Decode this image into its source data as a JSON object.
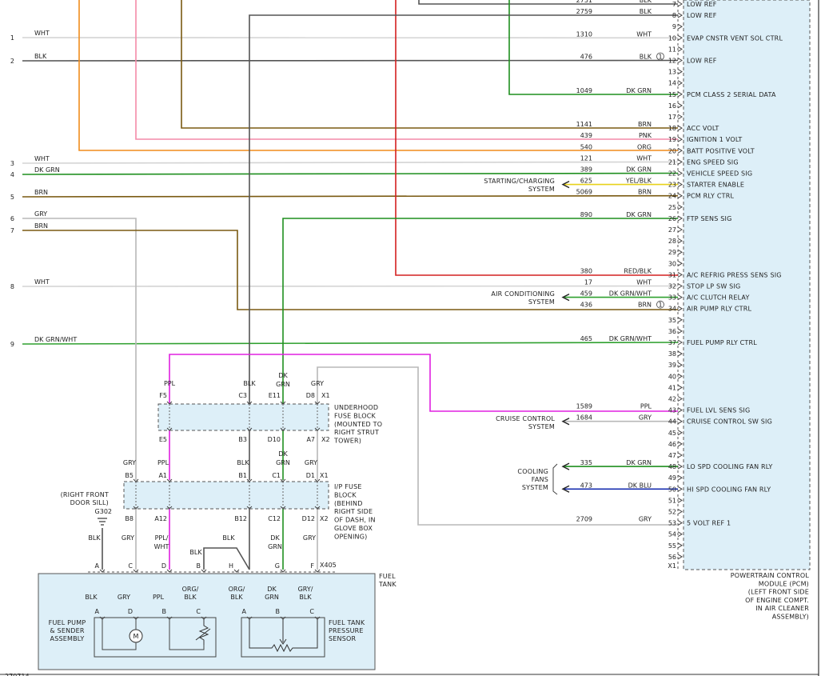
{
  "colors": {
    "WHT": "#d4d4d4",
    "BLK": "#555555",
    "DK GRN": "#1f8f1f",
    "BRN": "#7a5a12",
    "GRY": "#b8b8b8",
    "DK GRN/WHT": "#2fa02f",
    "PNK": "#f48aa8",
    "ORG": "#f08c1c",
    "RED/BLK": "#d42020",
    "PPL": "#e020e0",
    "YEL/BLK": "#e8d21a",
    "DK BLU": "#1a2fb0",
    "module_fill": "#ddeff8",
    "frame": "#444444"
  },
  "pcm": {
    "pins": [
      {
        "pin": "7",
        "wire_no": "2751",
        "color": "BLK",
        "name": "LOW REF"
      },
      {
        "pin": "8",
        "wire_no": "2759",
        "color": "BLK",
        "name": "LOW REF"
      },
      {
        "pin": "9",
        "wire_no": "",
        "color": "",
        "name": ""
      },
      {
        "pin": "10",
        "wire_no": "1310",
        "color": "WHT",
        "name": "EVAP CNSTR VENT SOL CTRL"
      },
      {
        "pin": "11",
        "wire_no": "",
        "color": "",
        "name": ""
      },
      {
        "pin": "12",
        "wire_no": "476",
        "color": "BLK",
        "name": "LOW REF",
        "note": "1"
      },
      {
        "pin": "13",
        "wire_no": "",
        "color": "",
        "name": ""
      },
      {
        "pin": "14",
        "wire_no": "",
        "color": "",
        "name": ""
      },
      {
        "pin": "15",
        "wire_no": "1049",
        "color": "DK GRN",
        "name": "PCM CLASS 2 SERIAL DATA"
      },
      {
        "pin": "16",
        "wire_no": "",
        "color": "",
        "name": ""
      },
      {
        "pin": "17",
        "wire_no": "",
        "color": "",
        "name": ""
      },
      {
        "pin": "18",
        "wire_no": "1141",
        "color": "BRN",
        "name": "ACC VOLT"
      },
      {
        "pin": "19",
        "wire_no": "439",
        "color": "PNK",
        "name": "IGNITION 1 VOLT"
      },
      {
        "pin": "20",
        "wire_no": "540",
        "color": "ORG",
        "name": "BATT POSITIVE VOLT"
      },
      {
        "pin": "21",
        "wire_no": "121",
        "color": "WHT",
        "name": "ENG SPEED SIG"
      },
      {
        "pin": "22",
        "wire_no": "389",
        "color": "DK GRN",
        "name": "VEHICLE SPEED SIG"
      },
      {
        "pin": "23",
        "wire_no": "625",
        "color": "YEL/BLK",
        "name": "STARTER ENABLE"
      },
      {
        "pin": "24",
        "wire_no": "5069",
        "color": "BRN",
        "name": "PCM RLY CTRL"
      },
      {
        "pin": "25",
        "wire_no": "",
        "color": "",
        "name": ""
      },
      {
        "pin": "26",
        "wire_no": "890",
        "color": "DK GRN",
        "name": "FTP SENS SIG"
      },
      {
        "pin": "27",
        "wire_no": "",
        "color": "",
        "name": ""
      },
      {
        "pin": "28",
        "wire_no": "",
        "color": "",
        "name": ""
      },
      {
        "pin": "29",
        "wire_no": "",
        "color": "",
        "name": ""
      },
      {
        "pin": "30",
        "wire_no": "",
        "color": "",
        "name": ""
      },
      {
        "pin": "31",
        "wire_no": "380",
        "color": "RED/BLK",
        "name": "A/C REFRIG PRESS SENS SIG"
      },
      {
        "pin": "32",
        "wire_no": "17",
        "color": "WHT",
        "name": "STOP LP SW SIG"
      },
      {
        "pin": "33",
        "wire_no": "459",
        "color": "DK GRN/WHT",
        "name": "A/C CLUTCH RELAY"
      },
      {
        "pin": "34",
        "wire_no": "436",
        "color": "BRN",
        "name": "AIR PUMP RLY CTRL",
        "note": "1"
      },
      {
        "pin": "35",
        "wire_no": "",
        "color": "",
        "name": ""
      },
      {
        "pin": "36",
        "wire_no": "",
        "color": "",
        "name": ""
      },
      {
        "pin": "37",
        "wire_no": "465",
        "color": "DK GRN/WHT",
        "name": "FUEL PUMP RLY CTRL"
      },
      {
        "pin": "38",
        "wire_no": "",
        "color": "",
        "name": ""
      },
      {
        "pin": "39",
        "wire_no": "",
        "color": "",
        "name": ""
      },
      {
        "pin": "40",
        "wire_no": "",
        "color": "",
        "name": ""
      },
      {
        "pin": "41",
        "wire_no": "",
        "color": "",
        "name": ""
      },
      {
        "pin": "42",
        "wire_no": "",
        "color": "",
        "name": ""
      },
      {
        "pin": "43",
        "wire_no": "1589",
        "color": "PPL",
        "name": "FUEL LVL SENS SIG"
      },
      {
        "pin": "44",
        "wire_no": "1684",
        "color": "GRY",
        "name": "CRUISE CONTROL SW SIG"
      },
      {
        "pin": "45",
        "wire_no": "",
        "color": "",
        "name": ""
      },
      {
        "pin": "46",
        "wire_no": "",
        "color": "",
        "name": ""
      },
      {
        "pin": "47",
        "wire_no": "",
        "color": "",
        "name": ""
      },
      {
        "pin": "48",
        "wire_no": "335",
        "color": "DK GRN",
        "name": "LO SPD COOLING FAN RLY"
      },
      {
        "pin": "49",
        "wire_no": "",
        "color": "",
        "name": ""
      },
      {
        "pin": "50",
        "wire_no": "473",
        "color": "DK BLU",
        "name": "HI SPD COOLING FAN RLY"
      },
      {
        "pin": "51",
        "wire_no": "",
        "color": "",
        "name": ""
      },
      {
        "pin": "52",
        "wire_no": "",
        "color": "",
        "name": ""
      },
      {
        "pin": "53",
        "wire_no": "2709",
        "color": "GRY",
        "name": "5 VOLT REF 1"
      },
      {
        "pin": "54",
        "wire_no": "",
        "color": "",
        "name": ""
      },
      {
        "pin": "55",
        "wire_no": "",
        "color": "",
        "name": ""
      },
      {
        "pin": "56",
        "wire_no": "",
        "color": "",
        "name": ""
      }
    ],
    "connector": "X1",
    "title": [
      "POWERTRAIN CONTROL",
      "MODULE (PCM)",
      "(LEFT FRONT SIDE",
      "OF ENGINE COMPT.",
      "IN AIR CLEANER",
      "ASSEMBLY)"
    ]
  },
  "left_wires": [
    {
      "num": "1",
      "color": "WHT",
      "pin": "10"
    },
    {
      "num": "2",
      "color": "BLK",
      "pin": "12"
    },
    {
      "num": "3",
      "color": "WHT",
      "pin": "21"
    },
    {
      "num": "4",
      "color": "DK GRN",
      "pin": "22"
    },
    {
      "num": "5",
      "color": "BRN",
      "pin": "24"
    },
    {
      "num": "6",
      "color": "GRY",
      "pin": ""
    },
    {
      "num": "7",
      "color": "BRN",
      "pin": ""
    },
    {
      "num": "8",
      "color": "WHT",
      "pin": "32"
    },
    {
      "num": "9",
      "color": "DK GRN/WHT",
      "pin": "37"
    }
  ],
  "external_systems": {
    "starting": [
      "STARTING/CHARGING",
      "SYSTEM"
    ],
    "ac": [
      "AIR CONDITIONING",
      "SYSTEM"
    ],
    "cruise": [
      "CRUISE CONTROL",
      "SYSTEM"
    ],
    "cooling": [
      "COOLING",
      "FANS",
      "SYSTEM"
    ]
  },
  "underhood_block": {
    "label": [
      "UNDERHOOD",
      "FUSE BLOCK",
      "(MOUNTED TO",
      "RIGHT STRUT",
      "TOWER)"
    ],
    "top_conn": "X1",
    "bottom_conn": "X2",
    "top": [
      {
        "color": "PPL",
        "pin": "F5"
      },
      {
        "color": "BLK",
        "pin": "C3"
      },
      {
        "color": "DK GRN",
        "pin": "E11"
      },
      {
        "color": "GRY",
        "pin": "D8"
      }
    ],
    "bottom": [
      "E5",
      "B3",
      "D10",
      "A7"
    ]
  },
  "ip_block": {
    "label": [
      "I/P FUSE",
      "BLOCK",
      "(BEHIND",
      "RIGHT SIDE",
      "OF DASH, IN",
      "GLOVE BOX",
      "OPENING)"
    ],
    "top_conn": "X1",
    "bottom_conn": "X2",
    "top": [
      {
        "color": "GRY",
        "pin": "B5"
      },
      {
        "color": "PPL",
        "pin": "A1"
      },
      {
        "color": "BLK",
        "pin": "B1"
      },
      {
        "color": "DK GRN",
        "pin": "C1"
      },
      {
        "color": "GRY",
        "pin": "D1"
      }
    ],
    "bottom": [
      "B8",
      "A12",
      "B12",
      "C12",
      "D12"
    ]
  },
  "ground": {
    "location": [
      "(RIGHT FRONT",
      "DOOR SILL)"
    ],
    "name": "G302"
  },
  "x405": {
    "conn": "X405",
    "pins": [
      {
        "pin": "A",
        "color": "BLK"
      },
      {
        "pin": "C",
        "color": "GRY"
      },
      {
        "pin": "D",
        "color": "PPL/WHT"
      },
      {
        "pin": "B",
        "color": "BLK"
      },
      {
        "pin": "H",
        "color": "BLK"
      },
      {
        "pin": "G",
        "color": "DK GRN"
      },
      {
        "pin": "F",
        "color": "GRY"
      }
    ]
  },
  "fuel_tank": {
    "label": [
      "FUEL",
      "TANK"
    ],
    "pump_label": [
      "FUEL PUMP",
      "& SENDER",
      "ASSEMBLY"
    ],
    "sensor_label": [
      "FUEL TANK",
      "PRESSURE",
      "SENSOR"
    ],
    "pump_pins": [
      {
        "pin": "A",
        "color": "BLK"
      },
      {
        "pin": "D",
        "color": "GRY"
      },
      {
        "pin": "B",
        "color": "PPL"
      },
      {
        "pin": "C",
        "color": "ORG/ BLK"
      }
    ],
    "sensor_pins": [
      {
        "pin": "A",
        "color": "ORG/ BLK"
      },
      {
        "pin": "B",
        "color": "DK GRN"
      },
      {
        "pin": "C",
        "color": "GRY/ BLK"
      }
    ],
    "motor": "M"
  },
  "footer_id": "270714"
}
